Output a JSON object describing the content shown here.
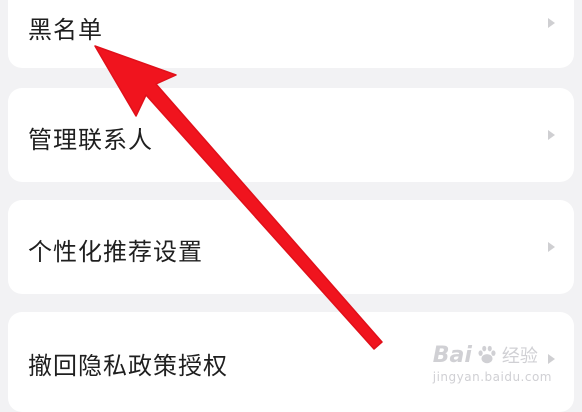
{
  "settings_list": {
    "items": [
      {
        "label": "黑名单"
      },
      {
        "label": "管理联系人"
      },
      {
        "label": "个性化推荐设置"
      },
      {
        "label": "撤回隐私政策授权"
      }
    ]
  },
  "watermark": {
    "logo_text": "Bai",
    "logo_text_2": "经验",
    "url": "jingyan.baidu.com"
  },
  "colors": {
    "background": "#f2f2f4",
    "card": "#ffffff",
    "arrow": "#f0141e",
    "text": "#1f1f1f"
  }
}
